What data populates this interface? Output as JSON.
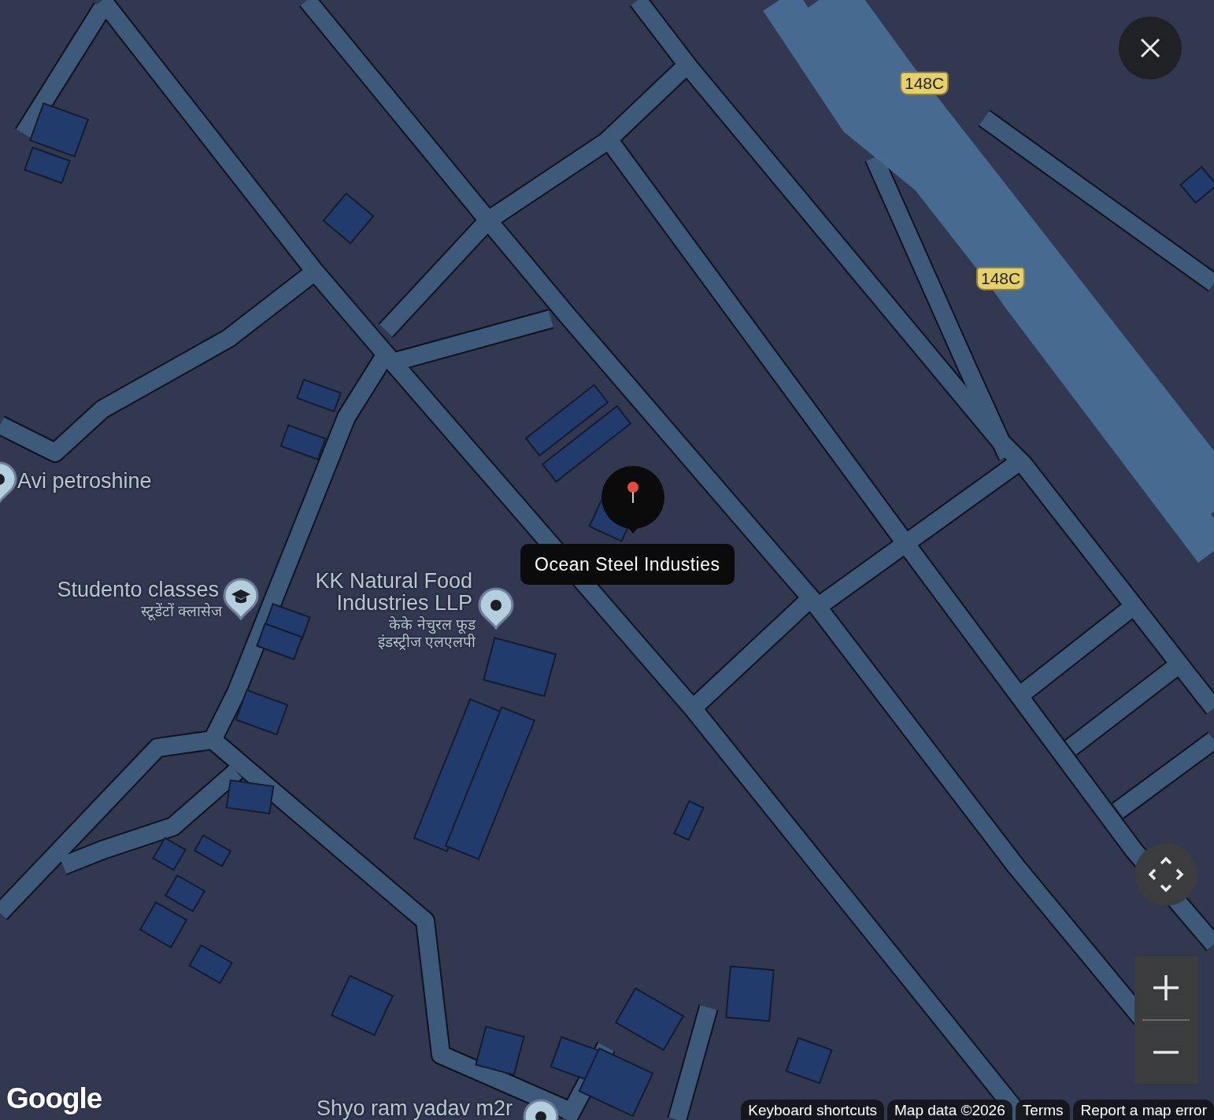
{
  "map": {
    "route_shields": [
      {
        "label": "148C"
      },
      {
        "label": "148C"
      }
    ],
    "places": [
      {
        "kind": "pin",
        "name": "Avi petroshine"
      },
      {
        "kind": "education",
        "name": "Studento classes",
        "local_name": "स्टूडेंटों क्लासेज"
      },
      {
        "kind": "pin",
        "name": "KK Natural Food Industries LLP",
        "local_name": "केके नेचुरल फूड इंडस्ट्रीज एलएलपी"
      },
      {
        "kind": "pin",
        "name": "Shyo ram yadav m2r"
      }
    ],
    "selected_place": {
      "label": "Ocean Steel Industies"
    }
  },
  "logo": "Google",
  "attribution": [
    {
      "label": "Keyboard shortcuts"
    },
    {
      "label": "Map data ©2026"
    },
    {
      "label": "Terms"
    },
    {
      "label": "Report a map error"
    }
  ]
}
